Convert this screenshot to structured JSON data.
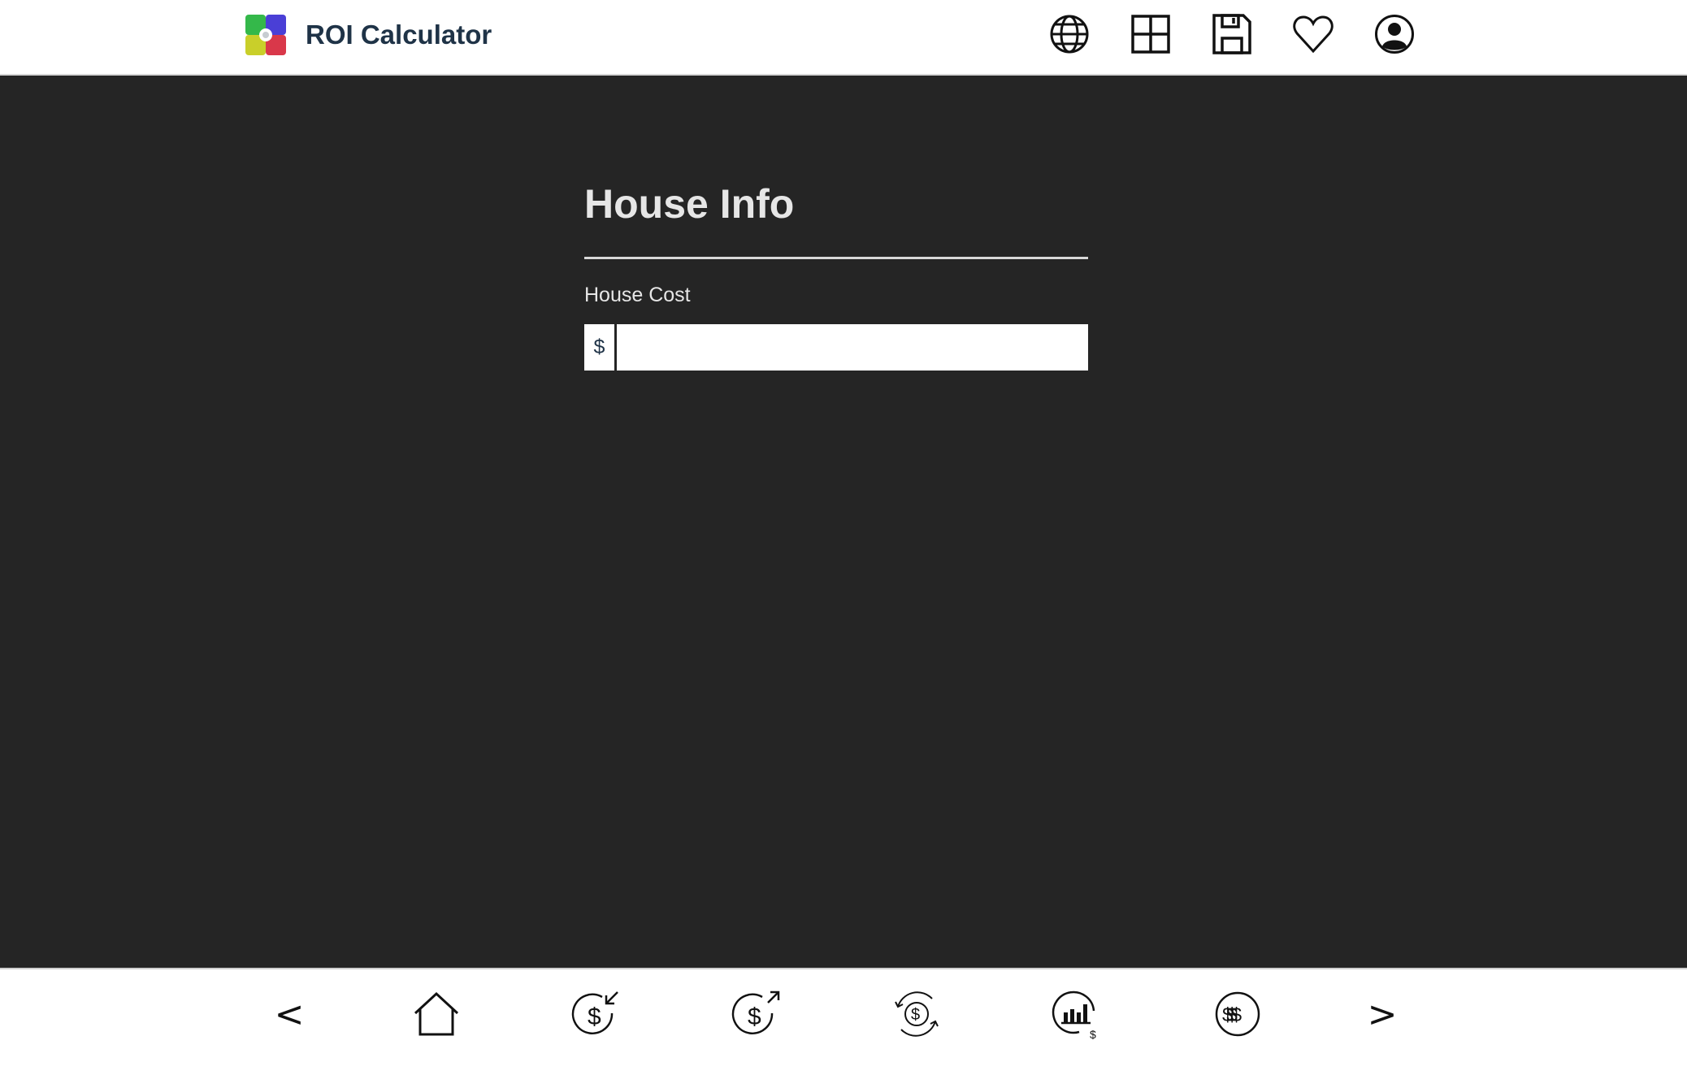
{
  "header": {
    "app_title": "ROI Calculator",
    "logo_icon": "app-logo-icon",
    "icons": [
      "globe-icon",
      "grid-icon",
      "save-icon",
      "heart-icon",
      "user-icon"
    ]
  },
  "main": {
    "section_title": "House Info",
    "fields": [
      {
        "label": "House Cost",
        "prefix": "$",
        "value": "",
        "placeholder": ""
      }
    ]
  },
  "bottom_nav": {
    "prev_label": "<",
    "next_label": ">",
    "icons": [
      "home-icon",
      "money-in-icon",
      "money-out-icon",
      "money-cycle-icon",
      "chart-dollar-icon",
      "multi-dollar-icon"
    ],
    "glyphs": {
      "dollar": "$",
      "multi_dollar": "$$$"
    }
  },
  "colors": {
    "background": "#252525",
    "bar": "#ffffff",
    "title_text": "#1f3347",
    "light_text": "#e6e6e6"
  }
}
